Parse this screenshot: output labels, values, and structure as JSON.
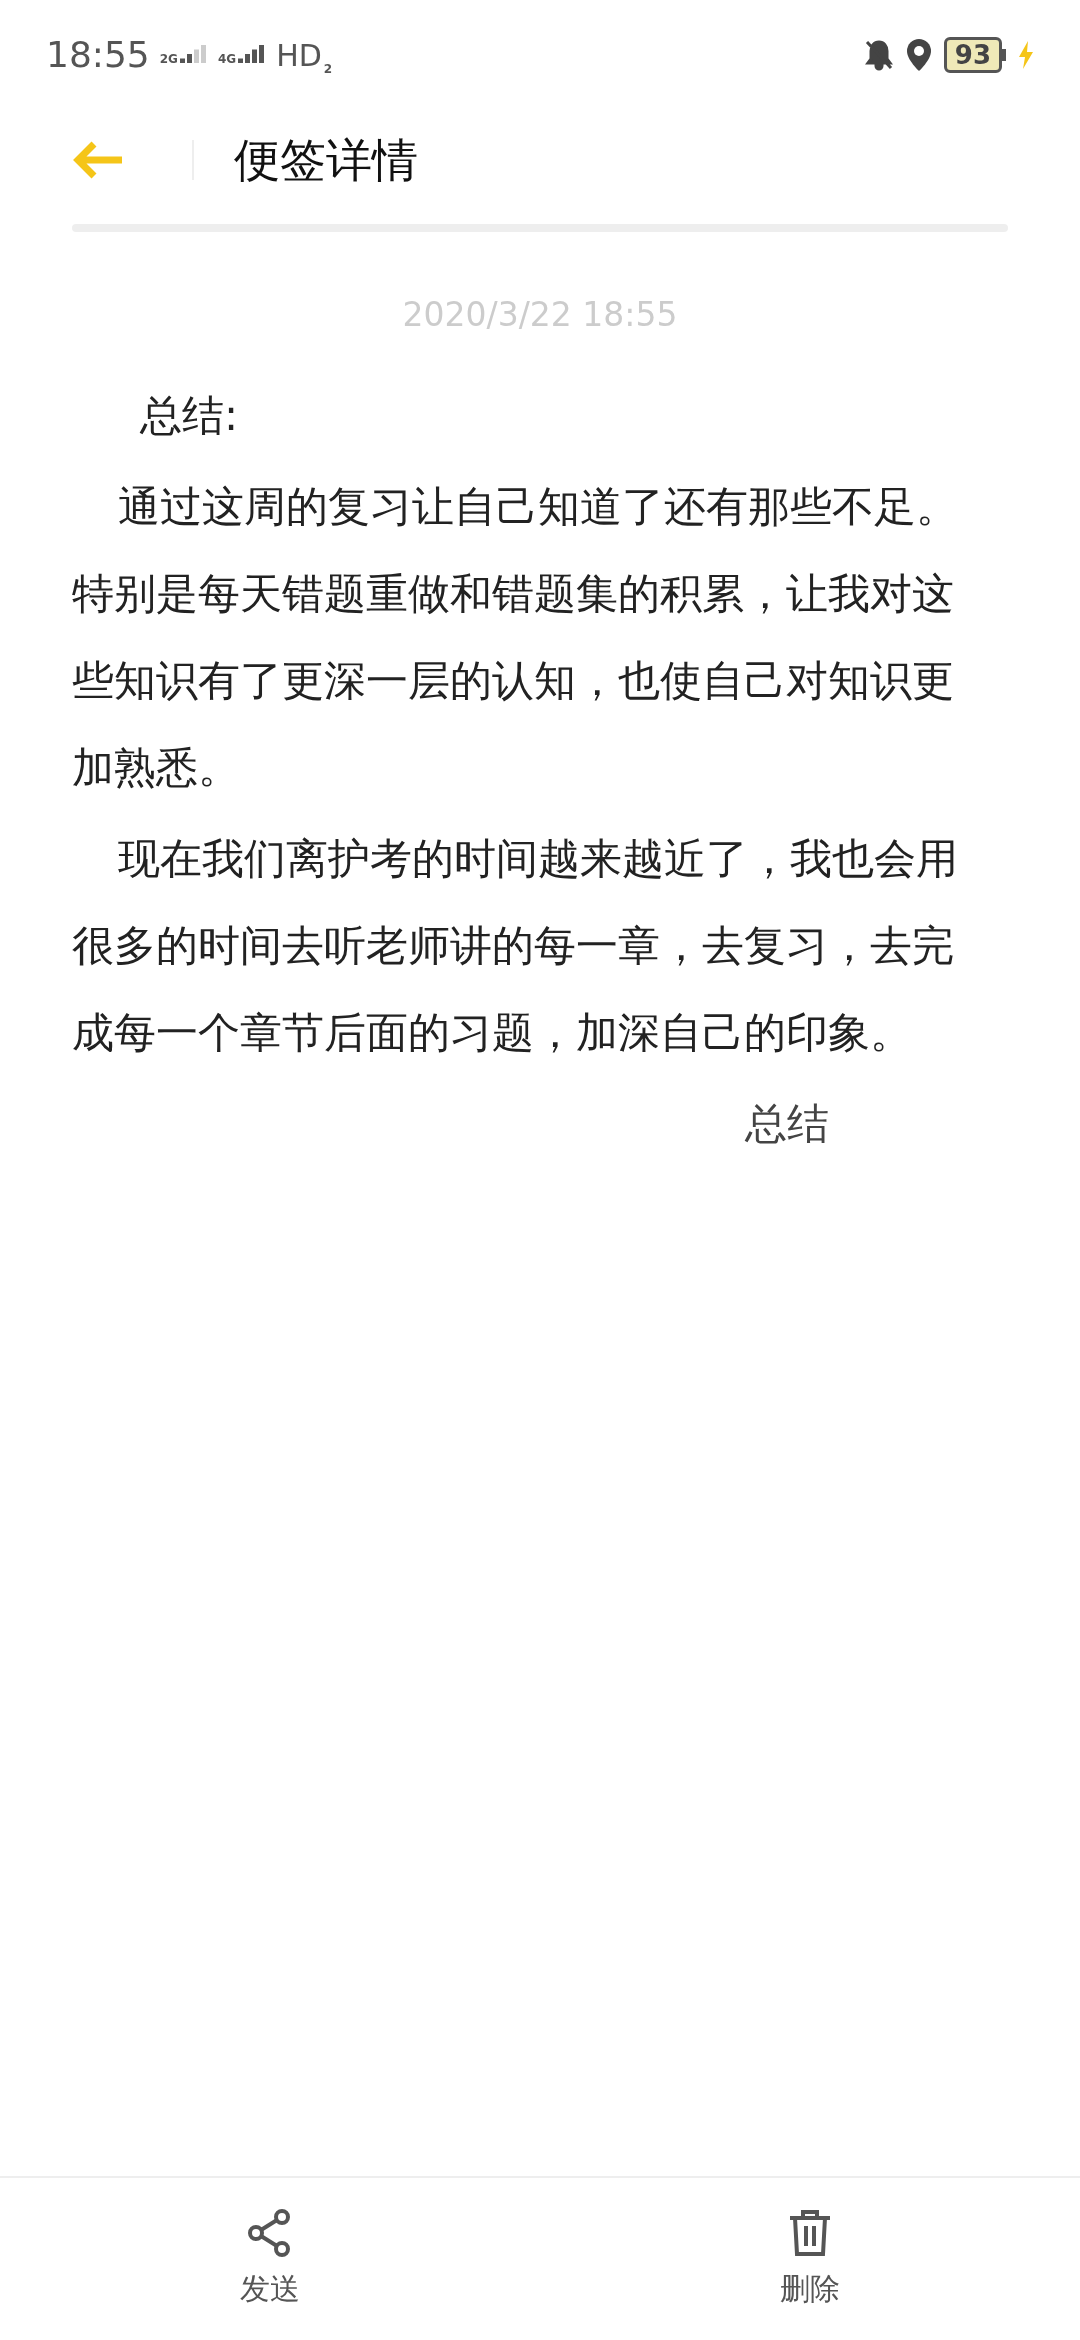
{
  "status_bar": {
    "time": "18:55",
    "sim1": "2G",
    "sim2": "4G",
    "hd": "HD",
    "hd_slot": "2",
    "battery": "93",
    "charging": true
  },
  "header": {
    "title": "便签详情"
  },
  "note": {
    "date": "2020/3/22 18:55",
    "heading": "总结:",
    "paragraphs": [
      "通过这周的复习让自己知道了还有那些不足。特别是每天错题重做和错题集的积累，让我对这些知识有了更深一层的认知，也使自己对知识更加熟悉。",
      "现在我们离护考的时间越来越近了，我也会用很多的时间去听老师讲的每一章，去复习，去完成每一个章节后面的习题，加深自己的印象。"
    ],
    "signature": "总结"
  },
  "actions": [
    {
      "kind": "share",
      "label": "发送"
    },
    {
      "kind": "delete",
      "label": "删除"
    }
  ]
}
